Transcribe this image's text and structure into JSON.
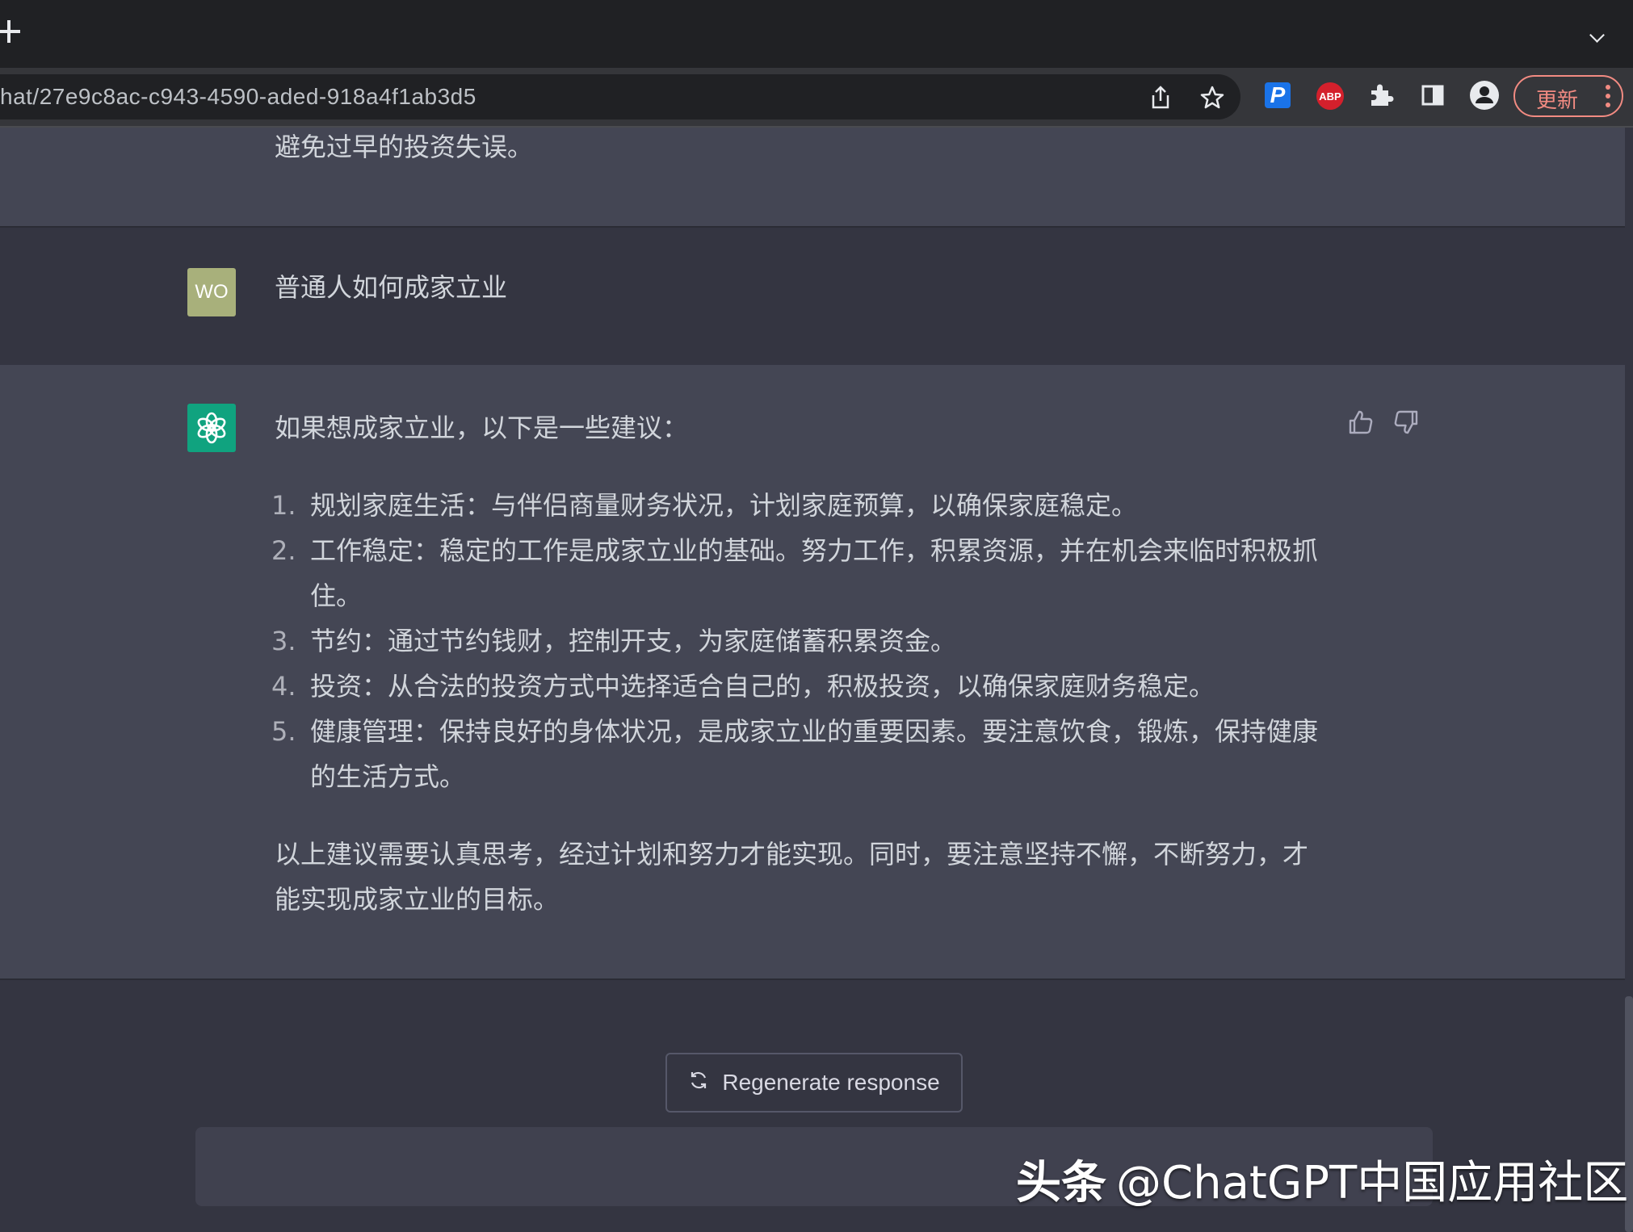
{
  "browser": {
    "url": "hat/27e9c8ac-c943-4590-aded-918a4f1ab3d5",
    "update_label": "更新",
    "extensions": {
      "p_label": "P",
      "abp_label": "ABP"
    },
    "icons": [
      "new-tab-icon",
      "tab-search-chevron-icon",
      "share-icon",
      "star-icon",
      "puzzle-extensions-icon",
      "side-panel-icon",
      "profile-icon",
      "more-vert-icon"
    ]
  },
  "chat": {
    "prev_answer_tail": "避免过早的投资失误。",
    "user_message": {
      "avatar_initials": "WO",
      "text": "普通人如何成家立业"
    },
    "assistant_message": {
      "intro": "如果想成家立业，以下是一些建议：",
      "items": [
        {
          "num": "1.",
          "text": "规划家庭生活：与伴侣商量财务状况，计划家庭预算，以确保家庭稳定。"
        },
        {
          "num": "2.",
          "text": "工作稳定：稳定的工作是成家立业的基础。努力工作，积累资源，并在机会来临时积极抓住。"
        },
        {
          "num": "3.",
          "text": "节约：通过节约钱财，控制开支，为家庭储蓄积累资金。"
        },
        {
          "num": "4.",
          "text": "投资：从合法的投资方式中选择适合自己的，积极投资，以确保家庭财务稳定。"
        },
        {
          "num": "5.",
          "text": "健康管理：保持良好的身体状况，是成家立业的重要因素。要注意饮食，锻炼，保持健康的生活方式。"
        }
      ],
      "conclusion_line1": "以上建议需要认真思考，经过计划和努力才能实现。同时，要注意坚持不懈，不断努力，才",
      "conclusion_line2": "能实现成家立业的目标。"
    },
    "regenerate_label": "Regenerate response"
  },
  "watermark": {
    "brand": "头条",
    "handle": "@ChatGPT中国应用社区"
  },
  "colors": {
    "accent_gpt": "#10a37f",
    "user_avatar": "#a8b07b",
    "assistant_row_bg": "#444654",
    "user_row_bg": "#343541",
    "update_accent": "#f28b82"
  }
}
